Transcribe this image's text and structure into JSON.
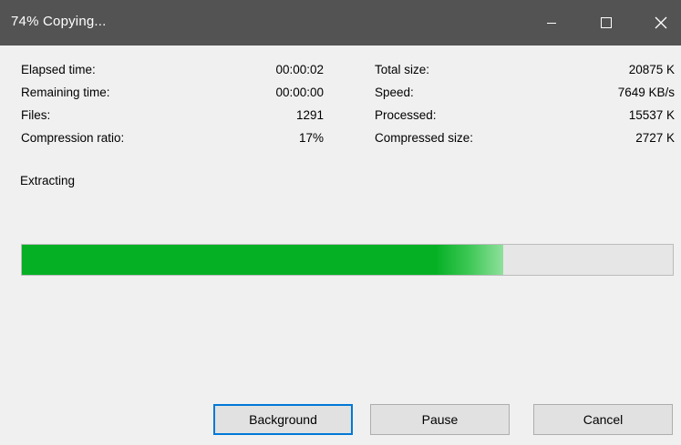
{
  "window": {
    "title": "74% Copying...",
    "controls": {
      "minimize": "minimize-icon",
      "maximize": "maximize-icon",
      "close": "close-icon"
    }
  },
  "stats": {
    "elapsed_time_label": "Elapsed time:",
    "elapsed_time_value": "00:00:02",
    "remaining_time_label": "Remaining time:",
    "remaining_time_value": "00:00:00",
    "files_label": "Files:",
    "files_value": "1291",
    "compression_ratio_label": "Compression ratio:",
    "compression_ratio_value": "17%",
    "total_size_label": "Total size:",
    "total_size_value": "20875 K",
    "speed_label": "Speed:",
    "speed_value": "7649 KB/s",
    "processed_label": "Processed:",
    "processed_value": "15537 K",
    "compressed_size_label": "Compressed size:",
    "compressed_size_value": "2727 K"
  },
  "status": {
    "label": "Extracting"
  },
  "progress": {
    "percent": 74
  },
  "buttons": {
    "background": "Background",
    "pause": "Pause",
    "cancel": "Cancel"
  },
  "colors": {
    "titlebar": "#535353",
    "progress_fill": "#06b025",
    "default_button_border": "#0078d7"
  }
}
